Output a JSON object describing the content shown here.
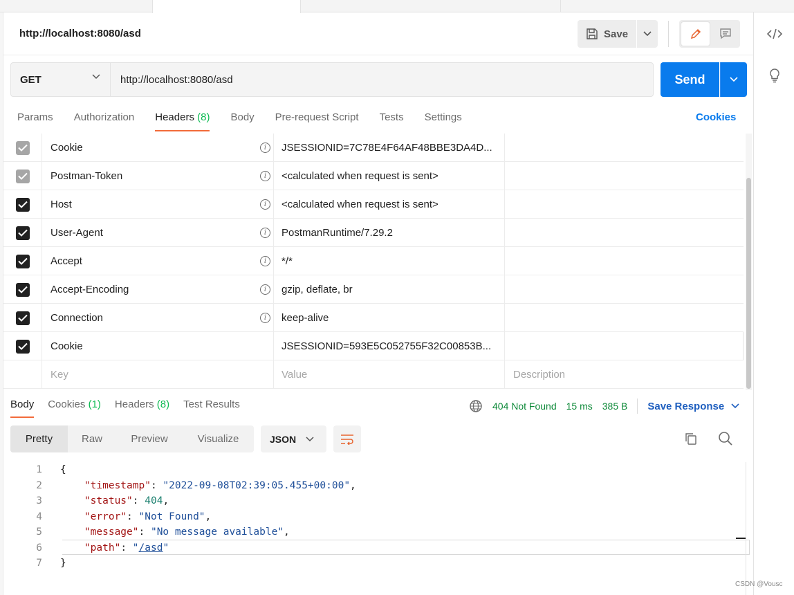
{
  "request": {
    "title": "http://localhost:8080/asd",
    "method": "GET",
    "url": "http://localhost:8080/asd",
    "save_label": "Save",
    "send_label": "Send",
    "cookies_label": "Cookies"
  },
  "req_tabs": [
    {
      "label": "Params"
    },
    {
      "label": "Authorization"
    },
    {
      "label": "Headers",
      "count": "(8)"
    },
    {
      "label": "Body"
    },
    {
      "label": "Pre-request Script"
    },
    {
      "label": "Tests"
    },
    {
      "label": "Settings"
    }
  ],
  "headers": [
    {
      "key": "Cookie",
      "value": "JSESSIONID=7C78E4F64AF48BBE3DA4D...",
      "state": "auto"
    },
    {
      "key": "Postman-Token",
      "value": "<calculated when request is sent>",
      "state": "auto"
    },
    {
      "key": "Host",
      "value": "<calculated when request is sent>",
      "state": "on"
    },
    {
      "key": "User-Agent",
      "value": "PostmanRuntime/7.29.2",
      "state": "on"
    },
    {
      "key": "Accept",
      "value": "*/*",
      "state": "on"
    },
    {
      "key": "Accept-Encoding",
      "value": "gzip, deflate, br",
      "state": "on"
    },
    {
      "key": "Connection",
      "value": "keep-alive",
      "state": "on"
    },
    {
      "key": "Cookie",
      "value": "JSESSIONID=593E5C052755F32C00853B...",
      "state": "on"
    }
  ],
  "placeholders": {
    "key": "Key",
    "value": "Value",
    "description": "Description"
  },
  "resp_tabs": [
    {
      "label": "Body"
    },
    {
      "label": "Cookies",
      "count": "(1)"
    },
    {
      "label": "Headers",
      "count": "(8)"
    },
    {
      "label": "Test Results"
    }
  ],
  "response": {
    "status": "404 Not Found",
    "time": "15 ms",
    "size": "385 B",
    "save_response": "Save Response"
  },
  "view_modes": [
    "Pretty",
    "Raw",
    "Preview",
    "Visualize"
  ],
  "format": "JSON",
  "code": {
    "line_numbers": [
      "1",
      "2",
      "3",
      "4",
      "5",
      "6",
      "7"
    ],
    "open_brace": "{",
    "close_brace": "}",
    "timestamp_key": "\"timestamp\"",
    "timestamp_val": "\"2022-09-08T02:39:05.455+00:00\"",
    "status_key": "\"status\"",
    "status_val": "404",
    "error_key": "\"error\"",
    "error_val": "\"Not Found\"",
    "message_key": "\"message\"",
    "message_val": "\"No message available\"",
    "path_key": "\"path\"",
    "path_val": "/asd",
    "quote": "\""
  },
  "watermark": "CSDN @Vousc"
}
